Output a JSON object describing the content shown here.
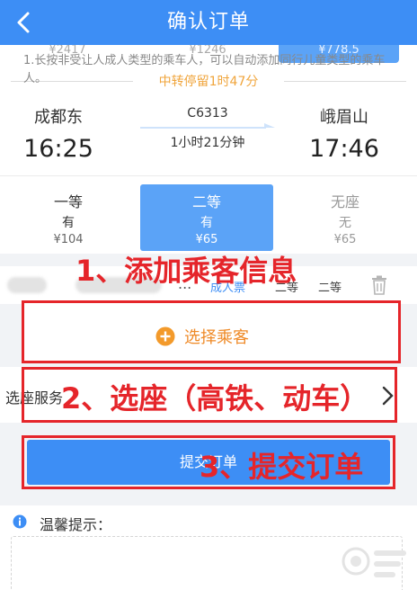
{
  "header": {
    "title": "确认订单",
    "back_icon": "chevron-left-icon"
  },
  "train": {
    "top_prices": [
      "¥2417",
      "¥1246",
      "¥778.5"
    ],
    "transfer_note": "中转停留1时47分",
    "from_station": "成都东",
    "from_time": "16:25",
    "to_station": "峨眉山",
    "to_time": "17:46",
    "train_no": "C6313",
    "duration": "1小时21分钟",
    "seats": [
      {
        "name": "一等",
        "availability": "有",
        "price": "¥104"
      },
      {
        "name": "二等",
        "availability": "有",
        "price": "¥65"
      },
      {
        "name": "无座",
        "availability": "无",
        "price": "¥65"
      }
    ],
    "selected_seat_index": 1
  },
  "passenger": {
    "ellipsis": "...",
    "ticket_type": "成人票",
    "seat_class_1": "二等",
    "seat_class_2": "二等",
    "delete_icon": "trash-icon"
  },
  "select_passenger": {
    "label": "选择乘客",
    "icon": "plus-circle-icon"
  },
  "seat_service": {
    "label": "选座服务",
    "icon": "chevron-right-icon"
  },
  "submit": {
    "label": "提交订单"
  },
  "tips": {
    "title": "温馨提示：",
    "text": "1.长按非受让人成人类型的乘车人，可以自动添加同行儿童类型的乘车人。",
    "icon": "info-icon"
  },
  "annotations": {
    "step1": "1、添加乘客信息",
    "step2": "2、选座（高铁、动车）",
    "step3": "3、提交订单"
  },
  "colors": {
    "primary": "#3d8ef5",
    "selected_seat": "#5ba3f7",
    "accent_orange": "#ef8a27",
    "transfer_orange": "#f0a53c",
    "annotation_red": "#e5252a"
  }
}
